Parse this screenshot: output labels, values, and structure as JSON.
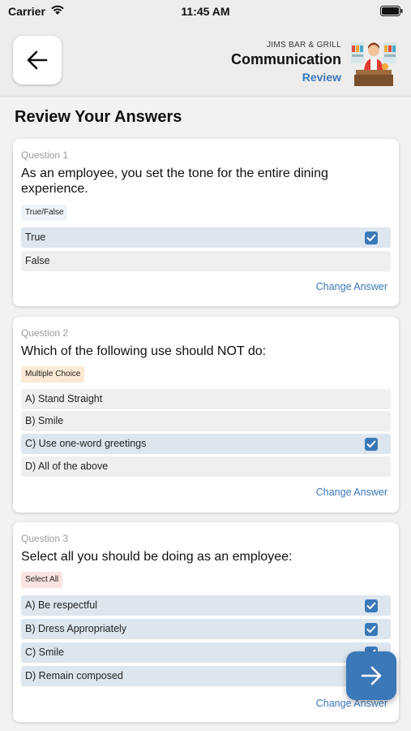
{
  "status": {
    "carrier": "Carrier",
    "time": "11:45 AM"
  },
  "header": {
    "subtitle": "JIMS BAR & GRILL",
    "title": "Communication",
    "mode": "Review",
    "back_icon": "arrow-left-icon"
  },
  "page_title": "Review Your Answers",
  "change_label": "Change Answer",
  "colors": {
    "accent": "#3a78b8",
    "selected_bg": "#dde6ef",
    "option_bg": "#efefef"
  },
  "questions": [
    {
      "number": "Question 1",
      "text": "As an employee, you set the tone for the entire dining experience.",
      "type": "True/False",
      "options": [
        {
          "label": "True",
          "selected": true
        },
        {
          "label": "False",
          "selected": false
        }
      ]
    },
    {
      "number": "Question 2",
      "text": "Which of the following use should NOT do:",
      "type": "Multiple Choice",
      "options": [
        {
          "label": "A) Stand Straight",
          "selected": false
        },
        {
          "label": "B) Smile",
          "selected": false
        },
        {
          "label": "C) Use one-word greetings",
          "selected": true
        },
        {
          "label": "D) All of the above",
          "selected": false
        }
      ]
    },
    {
      "number": "Question 3",
      "text": "Select all you should be doing as an employee:",
      "type": "Select All",
      "options": [
        {
          "label": "A) Be respectful",
          "selected": true
        },
        {
          "label": "B) Dress Appropriately",
          "selected": true
        },
        {
          "label": "C) Smile",
          "selected": true
        },
        {
          "label": "D) Remain composed",
          "selected": true
        }
      ]
    }
  ],
  "fab_icon": "arrow-right-icon"
}
